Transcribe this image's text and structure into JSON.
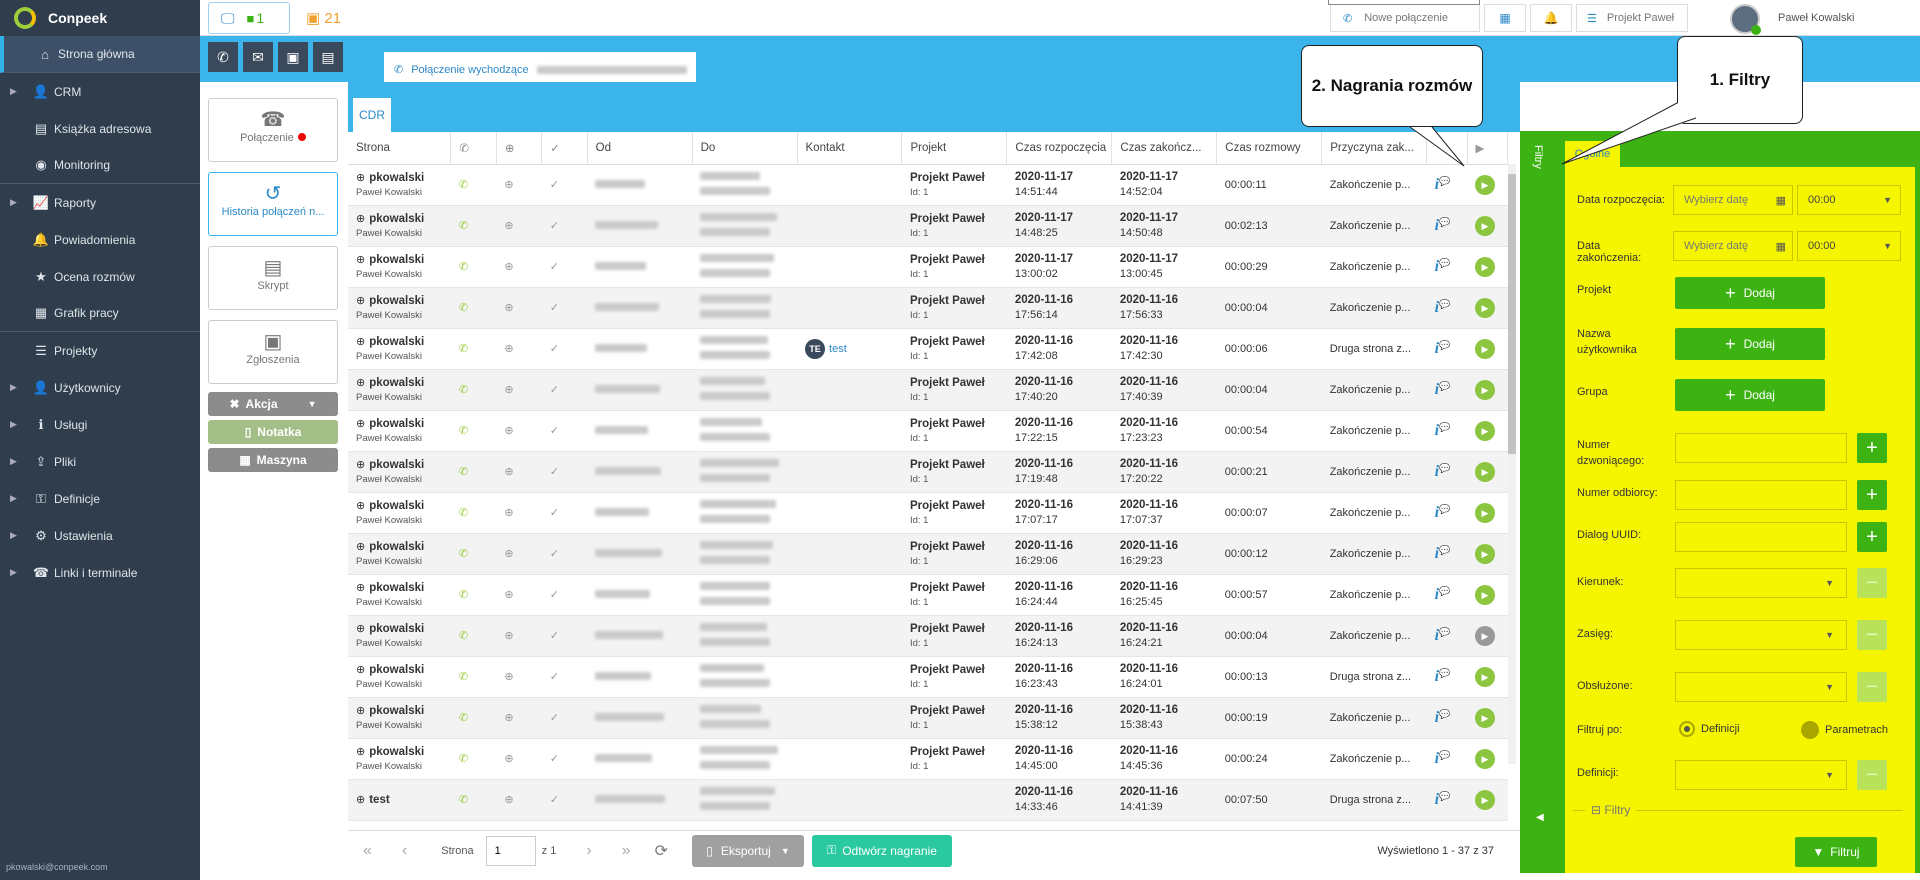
{
  "app": {
    "brand": "Conpeek",
    "user_email": "pkowalski@conpeek.com"
  },
  "sidebar": {
    "items": [
      {
        "label": "Strona główna",
        "icon": "home-icon",
        "active": true
      },
      {
        "label": "CRM",
        "icon": "person-icon",
        "expandable": true
      },
      {
        "label": "Książka adresowa",
        "icon": "address-book-icon"
      },
      {
        "label": "Monitoring",
        "icon": "eye-icon"
      },
      {
        "label": "Raporty",
        "icon": "chart-icon",
        "expandable": true
      },
      {
        "label": "Powiadomienia",
        "icon": "bell-icon"
      },
      {
        "label": "Ocena rozmów",
        "icon": "star-icon"
      },
      {
        "label": "Grafik pracy",
        "icon": "calendar-icon"
      },
      {
        "label": "Projekty",
        "icon": "list-icon"
      },
      {
        "label": "Użytkownicy",
        "icon": "users-icon",
        "expandable": true
      },
      {
        "label": "Usługi",
        "icon": "info-icon",
        "expandable": true
      },
      {
        "label": "Pliki",
        "icon": "upload-icon",
        "expandable": true
      },
      {
        "label": "Definicje",
        "icon": "key-icon",
        "expandable": true
      },
      {
        "label": "Ustawienia",
        "icon": "gears-icon",
        "expandable": true
      },
      {
        "label": "Linki i terminale",
        "icon": "phone-icon",
        "expandable": true
      }
    ]
  },
  "topbar": {
    "monitor_count": "1",
    "ticket_count": "21",
    "new_call": "Nowe połączenie",
    "project": "Projekt Paweł",
    "user_name": "Paweł Kowalski"
  },
  "call_tab": {
    "label": "Połączenie wychodzące"
  },
  "actions": {
    "call": "Połączenie",
    "history": "Historia połączeń n...",
    "script": "Skrypt",
    "tickets": "Zgłoszenia",
    "action": "Akcja",
    "note": "Notatka",
    "machine": "Maszyna"
  },
  "cdr": {
    "tab": "CDR",
    "columns": [
      "Strona",
      "",
      "",
      "",
      "Od",
      "Do",
      "Kontakt",
      "Projekt",
      "Czas rozpoczęcia",
      "Czas zakończ...",
      "Czas rozmowy",
      "Przyczyna zak..."
    ],
    "rows": [
      {
        "user": "pkowalski",
        "name": "Paweł Kowalski",
        "project": "Projekt Paweł",
        "pid": "Id: 1",
        "sd": "2020-11-17",
        "st": "14:51:44",
        "ed": "2020-11-17",
        "et": "14:52:04",
        "dur": "00:00:11",
        "reason": "Zakończenie p...",
        "contact": "",
        "play": "green"
      },
      {
        "user": "pkowalski",
        "name": "Paweł Kowalski",
        "project": "Projekt Paweł",
        "pid": "Id: 1",
        "sd": "2020-11-17",
        "st": "14:48:25",
        "ed": "2020-11-17",
        "et": "14:50:48",
        "dur": "00:02:13",
        "reason": "Zakończenie p...",
        "contact": "",
        "play": "green"
      },
      {
        "user": "pkowalski",
        "name": "Paweł Kowalski",
        "project": "Projekt Paweł",
        "pid": "Id: 1",
        "sd": "2020-11-17",
        "st": "13:00:02",
        "ed": "2020-11-17",
        "et": "13:00:45",
        "dur": "00:00:29",
        "reason": "Zakończenie p...",
        "contact": "",
        "play": "green"
      },
      {
        "user": "pkowalski",
        "name": "Paweł Kowalski",
        "project": "Projekt Paweł",
        "pid": "Id: 1",
        "sd": "2020-11-16",
        "st": "17:56:14",
        "ed": "2020-11-16",
        "et": "17:56:33",
        "dur": "00:00:04",
        "reason": "Zakończenie p...",
        "contact": "",
        "play": "green"
      },
      {
        "user": "pkowalski",
        "name": "Paweł Kowalski",
        "project": "Projekt Paweł",
        "pid": "Id: 1",
        "sd": "2020-11-16",
        "st": "17:42:08",
        "ed": "2020-11-16",
        "et": "17:42:30",
        "dur": "00:00:06",
        "reason": "Druga strona z...",
        "contact": "test",
        "contact_initials": "TE",
        "play": "green"
      },
      {
        "user": "pkowalski",
        "name": "Paweł Kowalski",
        "project": "Projekt Paweł",
        "pid": "Id: 1",
        "sd": "2020-11-16",
        "st": "17:40:20",
        "ed": "2020-11-16",
        "et": "17:40:39",
        "dur": "00:00:04",
        "reason": "Zakończenie p...",
        "contact": "",
        "play": "green"
      },
      {
        "user": "pkowalski",
        "name": "Paweł Kowalski",
        "project": "Projekt Paweł",
        "pid": "Id: 1",
        "sd": "2020-11-16",
        "st": "17:22:15",
        "ed": "2020-11-16",
        "et": "17:23:23",
        "dur": "00:00:54",
        "reason": "Zakończenie p...",
        "contact": "",
        "play": "green"
      },
      {
        "user": "pkowalski",
        "name": "Paweł Kowalski",
        "project": "Projekt Paweł",
        "pid": "Id: 1",
        "sd": "2020-11-16",
        "st": "17:19:48",
        "ed": "2020-11-16",
        "et": "17:20:22",
        "dur": "00:00:21",
        "reason": "Zakończenie p...",
        "contact": "",
        "play": "green"
      },
      {
        "user": "pkowalski",
        "name": "Paweł Kowalski",
        "project": "Projekt Paweł",
        "pid": "Id: 1",
        "sd": "2020-11-16",
        "st": "17:07:17",
        "ed": "2020-11-16",
        "et": "17:07:37",
        "dur": "00:00:07",
        "reason": "Zakończenie p...",
        "contact": "",
        "play": "green"
      },
      {
        "user": "pkowalski",
        "name": "Paweł Kowalski",
        "project": "Projekt Paweł",
        "pid": "Id: 1",
        "sd": "2020-11-16",
        "st": "16:29:06",
        "ed": "2020-11-16",
        "et": "16:29:23",
        "dur": "00:00:12",
        "reason": "Zakończenie p...",
        "contact": "",
        "play": "green"
      },
      {
        "user": "pkowalski",
        "name": "Paweł Kowalski",
        "project": "Projekt Paweł",
        "pid": "Id: 1",
        "sd": "2020-11-16",
        "st": "16:24:44",
        "ed": "2020-11-16",
        "et": "16:25:45",
        "dur": "00:00:57",
        "reason": "Zakończenie p...",
        "contact": "",
        "play": "green"
      },
      {
        "user": "pkowalski",
        "name": "Paweł Kowalski",
        "project": "Projekt Paweł",
        "pid": "Id: 1",
        "sd": "2020-11-16",
        "st": "16:24:13",
        "ed": "2020-11-16",
        "et": "16:24:21",
        "dur": "00:00:04",
        "reason": "Zakończenie p...",
        "contact": "",
        "play": "gray"
      },
      {
        "user": "pkowalski",
        "name": "Paweł Kowalski",
        "project": "Projekt Paweł",
        "pid": "Id: 1",
        "sd": "2020-11-16",
        "st": "16:23:43",
        "ed": "2020-11-16",
        "et": "16:24:01",
        "dur": "00:00:13",
        "reason": "Druga strona z...",
        "contact": "",
        "play": "green"
      },
      {
        "user": "pkowalski",
        "name": "Paweł Kowalski",
        "project": "Projekt Paweł",
        "pid": "Id: 1",
        "sd": "2020-11-16",
        "st": "15:38:12",
        "ed": "2020-11-16",
        "et": "15:38:43",
        "dur": "00:00:19",
        "reason": "Zakończenie p...",
        "contact": "",
        "play": "green"
      },
      {
        "user": "pkowalski",
        "name": "Paweł Kowalski",
        "project": "Projekt Paweł",
        "pid": "Id: 1",
        "sd": "2020-11-16",
        "st": "14:45:00",
        "ed": "2020-11-16",
        "et": "14:45:36",
        "dur": "00:00:24",
        "reason": "Zakończenie p...",
        "contact": "",
        "play": "green"
      },
      {
        "user": "test",
        "name": "",
        "project": "",
        "pid": "",
        "sd": "2020-11-16",
        "st": "14:33:46",
        "ed": "2020-11-16",
        "et": "14:41:39",
        "dur": "00:07:50",
        "reason": "Druga strona z...",
        "contact": "",
        "play": "green"
      }
    ],
    "footer": {
      "page_label": "Strona",
      "page": "1",
      "of": "z 1",
      "export": "Eksportuj",
      "play_recording": "Odtwórz nagranie",
      "summary": "Wyświetlono 1 - 37 z 37"
    }
  },
  "filters": {
    "vertical_tab": "Filtry",
    "tab": "Ogólne",
    "start_label": "Data rozpoczęcia:",
    "end_label": "Data zakończenia:",
    "date_placeholder": "Wybierz datę",
    "time_value": "00:00",
    "project_label": "Projekt",
    "username_label": "Nazwa użytkownika",
    "group_label": "Grupa",
    "add": "Dodaj",
    "caller_label": "Numer dzwoniącego:",
    "callee_label": "Numer odbiorcy:",
    "uuid_label": "Dialog UUID:",
    "direction_label": "Kierunek:",
    "range_label": "Zasięg:",
    "handled_label": "Obsłużone:",
    "filter_by_label": "Filtruj po:",
    "opt_definitions": "Definicji",
    "opt_params": "Parametrach",
    "definitions_label": "Definicji:",
    "section": "Filtry",
    "apply": "Filtruj"
  },
  "annotations": {
    "filters": "1. Filtry",
    "recordings": "2. Nagrania rozmów"
  }
}
